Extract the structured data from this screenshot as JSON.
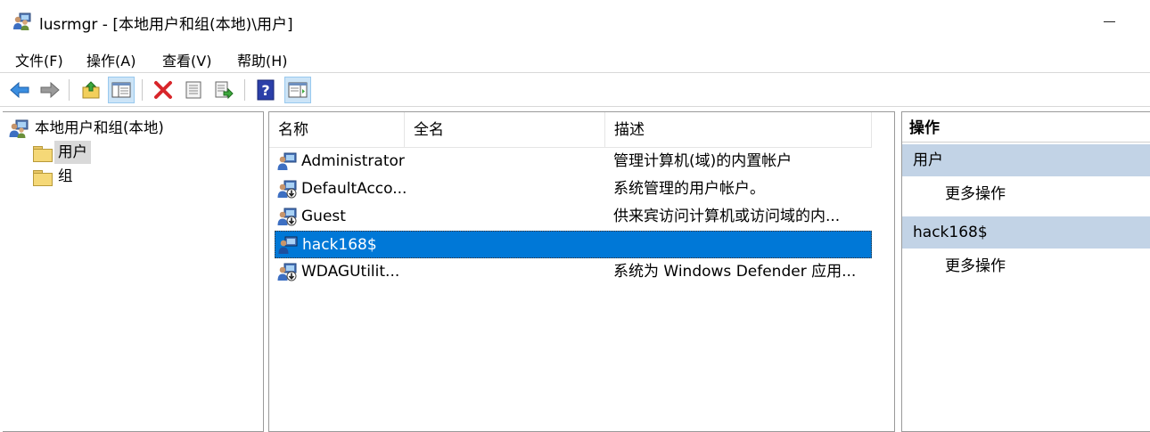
{
  "window": {
    "title": "lusrmgr - [本地用户和组(本地)\\用户]",
    "icon": "users-computer-icon"
  },
  "menubar": {
    "items": [
      {
        "label": "文件(F)"
      },
      {
        "label": "操作(A)"
      },
      {
        "label": "查看(V)"
      },
      {
        "label": "帮助(H)"
      }
    ]
  },
  "toolbar": {
    "buttons": [
      {
        "icon": "back-arrow-icon",
        "active": false
      },
      {
        "icon": "forward-arrow-icon",
        "active": false
      },
      {
        "icon": "up-folder-icon",
        "active": false
      },
      {
        "icon": "show-hide-tree-icon",
        "active": true
      },
      {
        "icon": "delete-icon",
        "active": false
      },
      {
        "icon": "properties-icon",
        "active": false
      },
      {
        "icon": "export-list-icon",
        "active": false
      },
      {
        "icon": "help-icon",
        "active": false
      },
      {
        "icon": "show-hide-action-pane-icon",
        "active": true
      }
    ]
  },
  "tree": {
    "root": "本地用户和组(本地)",
    "children": [
      {
        "label": "用户",
        "selected": true
      },
      {
        "label": "组",
        "selected": false
      }
    ]
  },
  "list": {
    "columns": [
      "名称",
      "全名",
      "描述"
    ],
    "rows": [
      {
        "name": "Administrator",
        "fullname": "",
        "description": "管理计算机(域)的内置帐户",
        "disabled": false,
        "selected": false
      },
      {
        "name": "DefaultAcco...",
        "fullname": "",
        "description": "系统管理的用户帐户。",
        "disabled": true,
        "selected": false
      },
      {
        "name": "Guest",
        "fullname": "",
        "description": "供来宾访问计算机或访问域的内...",
        "disabled": true,
        "selected": false
      },
      {
        "name": "hack168$",
        "fullname": "",
        "description": "",
        "disabled": false,
        "selected": true
      },
      {
        "name": "WDAGUtilit...",
        "fullname": "",
        "description": "系统为 Windows Defender 应用...",
        "disabled": true,
        "selected": false
      }
    ]
  },
  "actions": {
    "header": "操作",
    "sections": [
      {
        "title": "用户",
        "items": [
          "更多操作"
        ]
      },
      {
        "title": "hack168$",
        "items": [
          "更多操作"
        ]
      }
    ]
  },
  "colors": {
    "selection": "#0078d7",
    "action_section": "#c2d3e6",
    "tree_selected": "#d9d9d9"
  }
}
